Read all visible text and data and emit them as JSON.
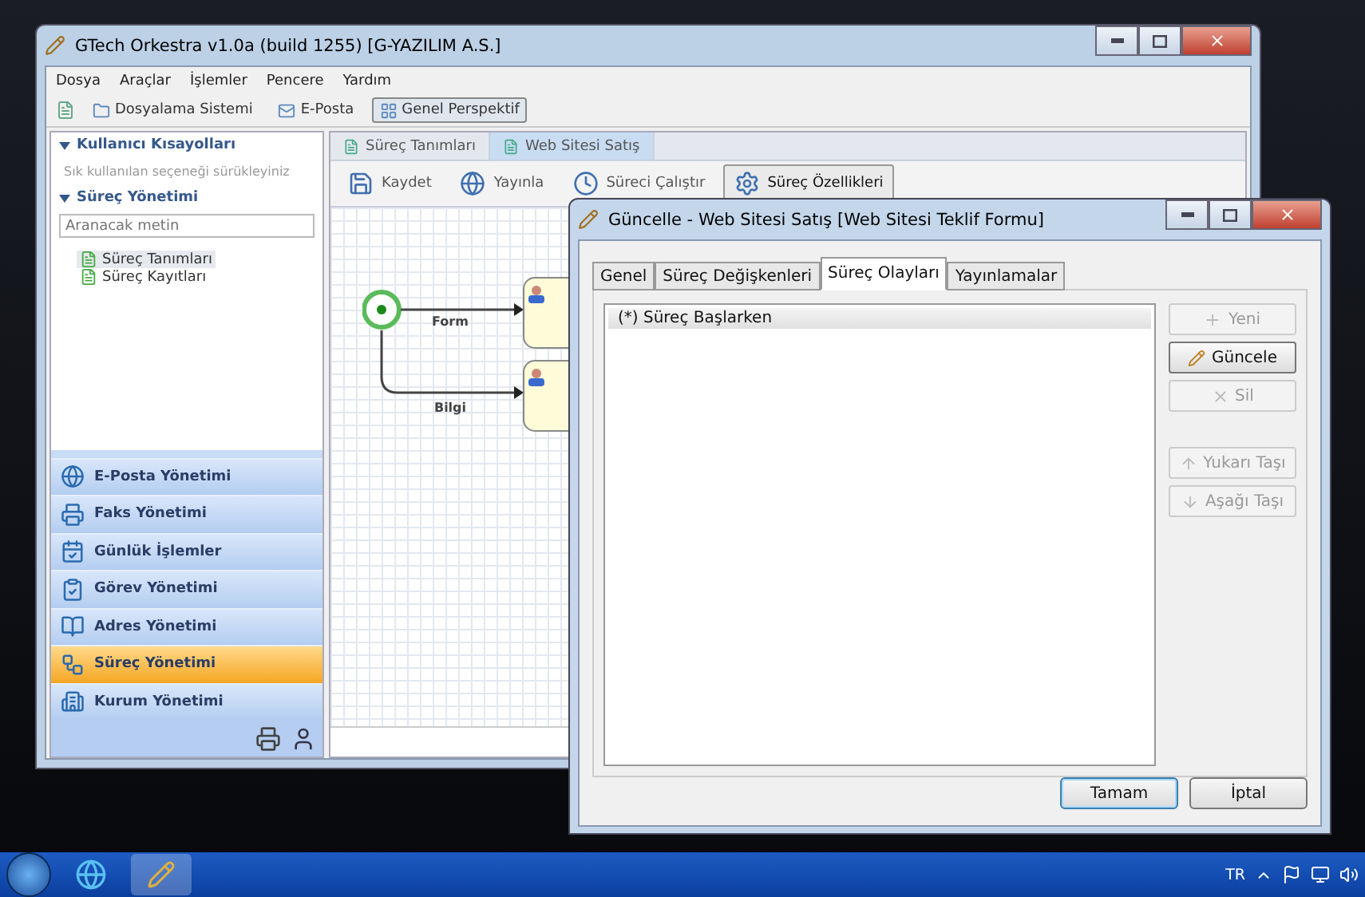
{
  "main_window": {
    "title": "GTech Orkestra v1.0a (build 1255) [G-YAZILIM A.S.]",
    "menu": [
      "Dosya",
      "Araçlar",
      "İşlemler",
      "Pencere",
      "Yardım"
    ],
    "toolbar": [
      {
        "label": "Dosyalama Sistemi",
        "selected": false
      },
      {
        "label": "E-Posta",
        "selected": false
      },
      {
        "label": "Genel Perspektif",
        "selected": true
      }
    ],
    "shortcuts": {
      "title": "Kullanıcı Kısayolları",
      "hint": "Sık kullanılan seçeneği sürükleyiniz"
    },
    "process_panel": {
      "title": "Süreç Yönetimi",
      "search": {
        "placeholder": "Aranacak metin"
      },
      "items": [
        {
          "label": "Süreç Tanımları",
          "selected": true
        },
        {
          "label": "Süreç Kayıtları",
          "selected": false
        }
      ]
    },
    "nav": [
      {
        "label": "E-Posta Yönetimi",
        "selected": false
      },
      {
        "label": "Faks Yönetimi",
        "selected": false
      },
      {
        "label": "Günlük İşlemler",
        "selected": false
      },
      {
        "label": "Görev Yönetimi",
        "selected": false
      },
      {
        "label": "Adres Yönetimi",
        "selected": false
      },
      {
        "label": "Süreç Yönetimi",
        "selected": true
      },
      {
        "label": "Kurum Yönetimi",
        "selected": false
      }
    ],
    "editor_tabs": [
      {
        "label": "Süreç Tanımları",
        "selected": false
      },
      {
        "label": "Web Sitesi Satış",
        "selected": true
      }
    ],
    "editor_toolbar": [
      {
        "label": "Kaydet",
        "selected": false
      },
      {
        "label": "Yayınla",
        "selected": false
      },
      {
        "label": "Süreci Çalıştır",
        "selected": false
      },
      {
        "label": "Süreç Özellikleri",
        "selected": true
      }
    ],
    "diagram": {
      "edges": [
        "Form",
        "Bilgi"
      ]
    }
  },
  "dialog": {
    "title": "Güncelle - Web Sitesi Satış [Web Sitesi Teklif Formu]",
    "tabs": [
      {
        "label": "Genel",
        "selected": false
      },
      {
        "label": "Süreç Değişkenleri",
        "selected": false
      },
      {
        "label": "Süreç Olayları",
        "selected": true
      },
      {
        "label": "Yayınlamalar",
        "selected": false
      }
    ],
    "events": [
      {
        "label": "(*) Süreç Başlarken",
        "selected": true
      }
    ],
    "side_buttons": [
      {
        "label": "Yeni",
        "disabled": true
      },
      {
        "label": "Güncele",
        "disabled": false
      },
      {
        "label": "Sil",
        "disabled": true
      },
      {
        "label": "Yukarı Taşı",
        "disabled": true
      },
      {
        "label": "Aşağı Taşı",
        "disabled": true
      }
    ],
    "footer_buttons": [
      {
        "label": "Tamam",
        "selected": true
      },
      {
        "label": "İptal",
        "selected": false
      }
    ]
  },
  "taskbar": {
    "language": "TR"
  }
}
